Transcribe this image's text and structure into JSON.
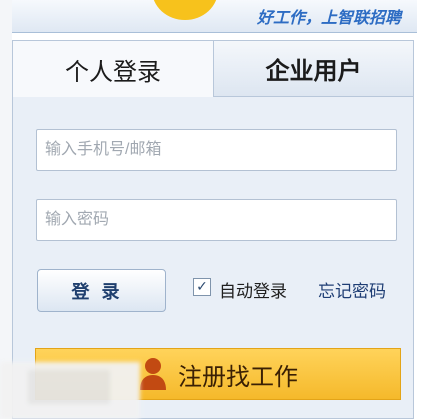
{
  "header": {
    "slogan": "好工作，上智联招聘"
  },
  "tabs": [
    {
      "label": "个人登录",
      "active": true
    },
    {
      "label": "企业用户",
      "active": false
    }
  ],
  "form": {
    "phone_placeholder": "输入手机号/邮箱",
    "password_placeholder": "输入密码",
    "login_label": "登录",
    "auto_login_label": "自动登录",
    "auto_login_checked": true,
    "forgot_password_label": "忘记密码"
  },
  "register": {
    "label": "注册找工作",
    "icon": "person-icon"
  },
  "colors": {
    "brand_yellow": "#f7c21c",
    "register_orange": "#f5b92b",
    "panel_bg": "#e9eff7",
    "slogan_blue": "#2d6cc3"
  }
}
